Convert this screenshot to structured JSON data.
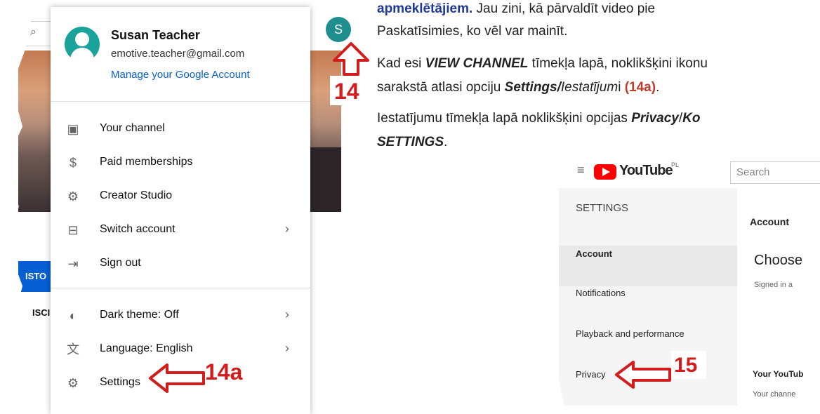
{
  "left_screenshot": {
    "customize_label": "ISTO",
    "discuss_label": "ISCI",
    "avatar_letter": "S",
    "profile": {
      "name": "Susan Teacher",
      "email": "emotive.teacher@gmail.com",
      "manage_link": "Manage your Google Account"
    },
    "menu_items": [
      {
        "label": "Your channel",
        "icon": "person-box-icon"
      },
      {
        "label": "Paid memberships",
        "icon": "dollar-circle-icon"
      },
      {
        "label": "Creator Studio",
        "icon": "gear-icon"
      },
      {
        "label": "Switch account",
        "icon": "switch-account-icon",
        "chevron": "›"
      },
      {
        "label": "Sign out",
        "icon": "sign-out-icon"
      },
      {
        "label": "Dark theme: Off",
        "icon": "dark-theme-icon",
        "chevron": "›"
      },
      {
        "label": "Language: English",
        "icon": "translate-icon",
        "chevron": "›"
      },
      {
        "label": "Settings",
        "icon": "gear-icon"
      }
    ],
    "callouts": {
      "step14": "14",
      "step14a": "14a"
    }
  },
  "instructions": {
    "line1_bold": "apmeklētājiem.",
    "line1_rest": " Jau zini, kā pārvaldīt video pie",
    "line2": "Paskatīsimies, ko vēl var mainīt.",
    "line3_a": "Kad esi ",
    "line3_b": "VIEW CHANNEL",
    "line3_c": " tīmekļa lapā, noklikšķini ikonu",
    "line4_a": "sarakstā atlasi opciju ",
    "line4_b": "Settings/",
    "line4_c": "Iestatījum",
    "line4_d": "i ",
    "line4_e": "(14a)",
    "line4_f": ".",
    "line5_a": "Iestatījumu tīmekļa lapā noklikšķini opcijas ",
    "line5_b": "Privacy",
    "line5_c": "/",
    "line5_d": "Ko",
    "line6": "SETTINGS",
    "line6_end": "."
  },
  "right_screenshot": {
    "logo_text": "YouTube",
    "logo_sup": "PL",
    "search_placeholder": "Search",
    "settings_heading": "SETTINGS",
    "sidebar_items": [
      "Account",
      "Notifications",
      "Playback and performance",
      "Privacy"
    ],
    "main_account": "Account",
    "main_choose": "Choose",
    "main_signed": "Signed in a",
    "main_your_youtube": "Your YouTub",
    "main_your_channel": "Your channe",
    "callout_step15": "15"
  },
  "colors": {
    "youtube_red": "#ff0000",
    "callout_red": "#d31c1c",
    "accent_blue": "#065fd4"
  }
}
